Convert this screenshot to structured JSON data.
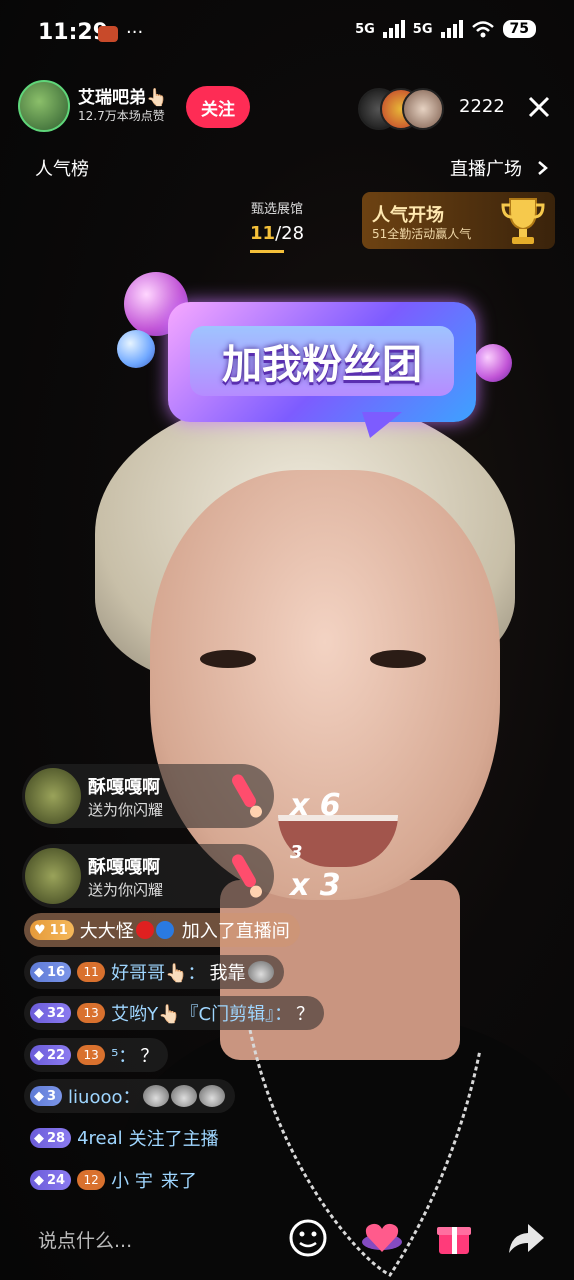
{
  "status_bar": {
    "time": "11:29",
    "net1": "5G",
    "net2": "5G",
    "battery": "75"
  },
  "host": {
    "name": "艾瑞吧弟👆🏻",
    "likes": "12.7万本场点赞",
    "follow_label": "关注"
  },
  "viewers": {
    "count": "2222"
  },
  "nav": {
    "rank_label": "人气榜",
    "square_label": "直播广场"
  },
  "gallery": {
    "label": "甄选展馆",
    "current": "11",
    "total": "/28"
  },
  "event": {
    "title": "人气开场",
    "subtitle": "51全勤活动赢人气"
  },
  "banner": {
    "text": "加我粉丝团"
  },
  "gifts": [
    {
      "user": "酥嘎嘎啊",
      "desc": "送为你闪耀",
      "multiplier": "x 6",
      "combo": ""
    },
    {
      "user": "酥嘎嘎啊",
      "desc": "送为你闪耀",
      "multiplier": "x 3",
      "combo": "3"
    }
  ],
  "chat": [
    {
      "level": "11",
      "user": "大大怪",
      "text": "加入了直播间"
    },
    {
      "level": "16",
      "fan": "11",
      "user": "好哥哥👆🏻：",
      "text": "我靠"
    },
    {
      "level": "32",
      "fan": "13",
      "user": "艾哟Y👆🏻『C门剪辑』：",
      "text": "？"
    },
    {
      "level": "22",
      "fan": "13",
      "user": "⁵：",
      "text": "？"
    },
    {
      "level": "3",
      "user": "liuooo：",
      "text": ""
    },
    {
      "level": "28",
      "user": "4real",
      "text": "关注了主播"
    },
    {
      "level": "24",
      "fan": "12",
      "user": "小 宇",
      "text": "来了"
    }
  ],
  "bottom": {
    "placeholder": "说点什么..."
  },
  "colors": {
    "follow": "#fe2c55",
    "accent_gold": "#f4c03a",
    "username": "#9fd6ff"
  },
  "icons": [
    "close-icon",
    "chevron-right-icon",
    "emoji-icon",
    "heart-icon",
    "gift-icon",
    "share-icon"
  ]
}
